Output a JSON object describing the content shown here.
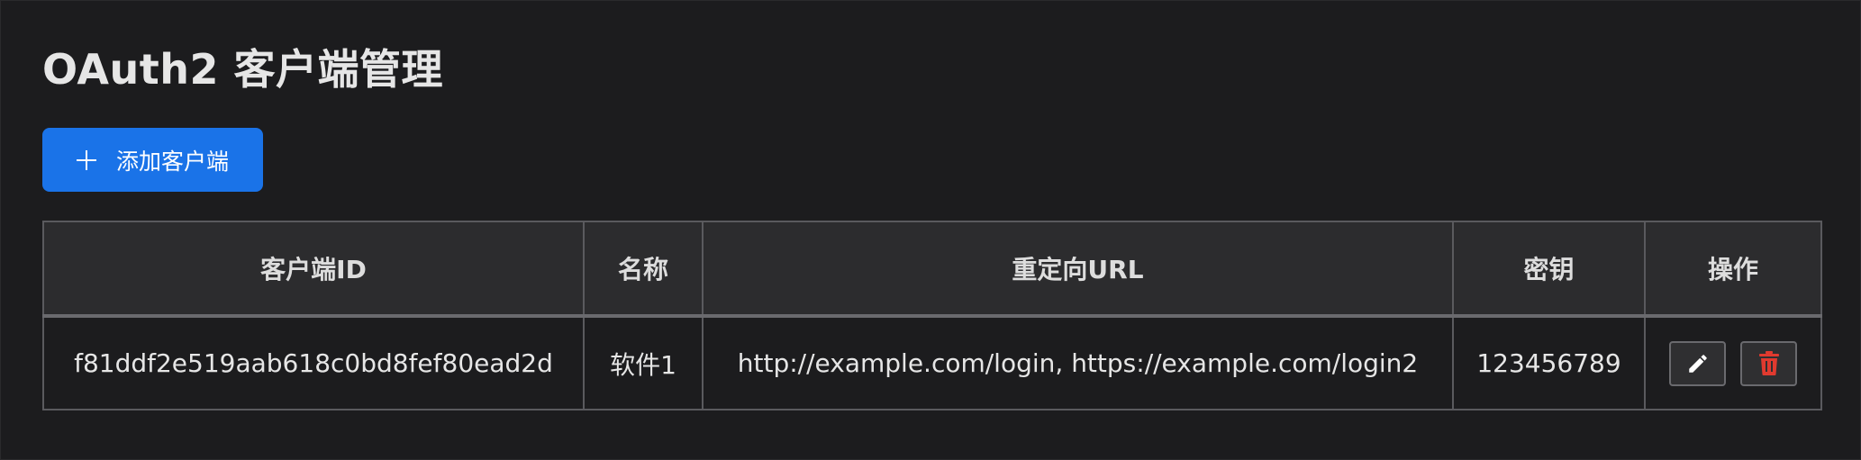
{
  "page": {
    "title": "OAuth2 客户端管理"
  },
  "toolbar": {
    "add_label": "添加客户端",
    "add_icon": "plus-icon"
  },
  "table": {
    "headers": [
      "客户端ID",
      "名称",
      "重定向URL",
      "密钥",
      "操作"
    ],
    "rows": [
      {
        "client_id": "f81ddf2e519aab618c0bd8fef80ead2d",
        "name": "软件1",
        "redirect_url": "http://example.com/login, https://example.com/login2",
        "secret": "123456789",
        "actions": [
          "edit-icon",
          "delete-icon"
        ]
      }
    ]
  },
  "colors": {
    "background": "#1c1c1e",
    "header_background": "#2c2c2e",
    "accent": "#1a73e8",
    "delete": "#e03a2f",
    "border": "#5a5a5e"
  }
}
